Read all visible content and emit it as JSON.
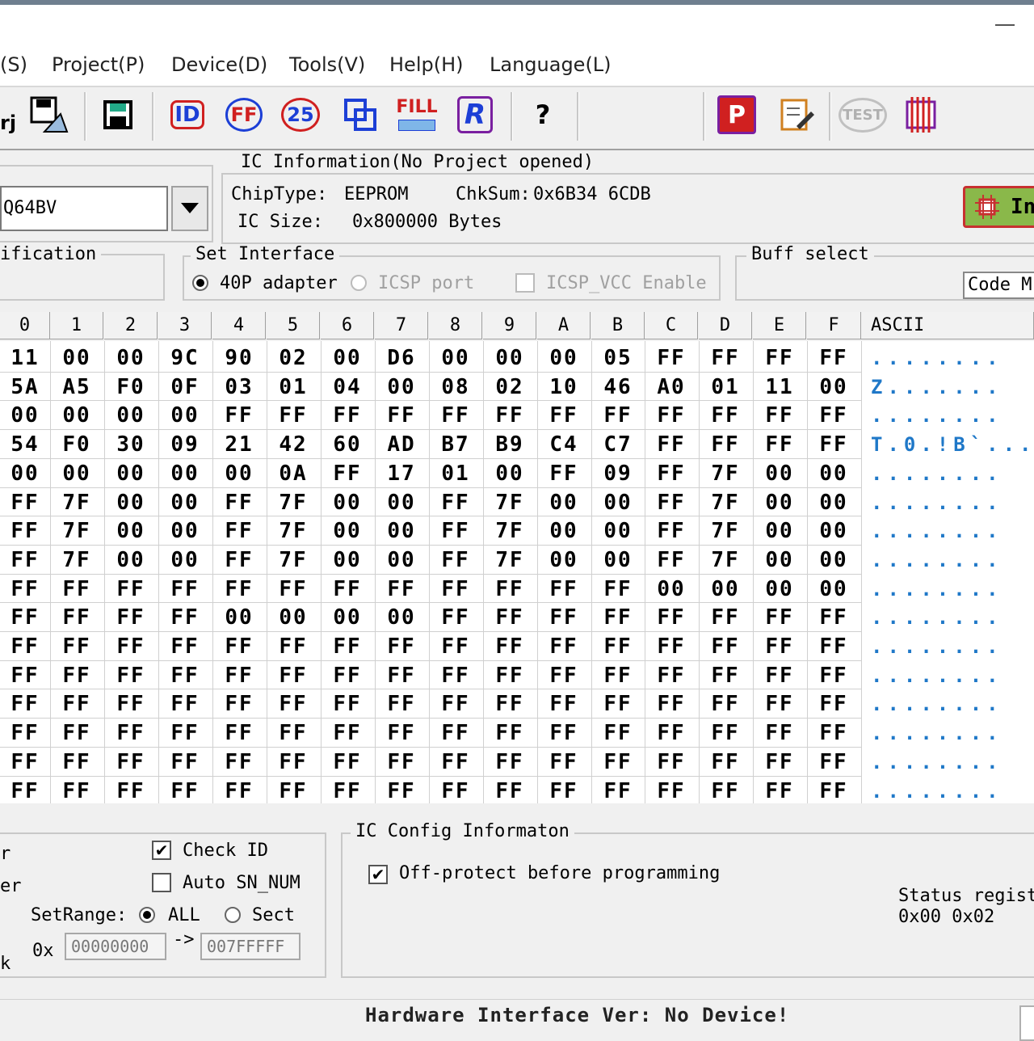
{
  "menu": [
    "(S)",
    "Project(P)",
    "Device(D)",
    "Tools(V)",
    "Help(H)",
    "Language(L)"
  ],
  "toolbar": {
    "partial_label": "rj",
    "icons": [
      "save-project-icon",
      "save-buffer-icon",
      "read-id-icon",
      "erase-icon",
      "blank-check-icon",
      "verify-icon",
      "fill-icon",
      "read-icon",
      "help-icon",
      "program-icon",
      "edit-icon",
      "test-icon",
      "chip-icon"
    ],
    "fill_label": "FILL",
    "read_label": "R",
    "program_label": "P",
    "test_label": "TEST",
    "help_label": "?",
    "id_label": "ID",
    "ff_label": "FF",
    "blank_label": "25"
  },
  "chip": {
    "selected": "Q64BV"
  },
  "ic_info": {
    "title": "IC Information(No Project opened)",
    "chip_type_label": "ChipType:",
    "chip_type_value": "EEPROM",
    "chksum_label": "ChkSum:",
    "chksum_value": "0x6B34 6CDB",
    "ic_size_label": "IC Size:",
    "ic_size_value": "0x800000 Bytes"
  },
  "detect_button": "In",
  "verification_title": "ification",
  "set_interface": {
    "title": "Set Interface",
    "adapter_label": "40P adapter",
    "icsp_label": "ICSP port",
    "icsp_vcc_label": "ICSP_VCC Enable"
  },
  "buff_select": {
    "title": "Buff select",
    "value": "Code M"
  },
  "hex": {
    "columns": [
      "0",
      "1",
      "2",
      "3",
      "4",
      "5",
      "6",
      "7",
      "8",
      "9",
      "A",
      "B",
      "C",
      "D",
      "E",
      "F"
    ],
    "ascii_header": "ASCII",
    "rows": [
      [
        "11",
        "00",
        "00",
        "9C",
        "90",
        "02",
        "00",
        "D6",
        "00",
        "00",
        "00",
        "05",
        "FF",
        "FF",
        "FF",
        "FF"
      ],
      [
        "5A",
        "A5",
        "F0",
        "0F",
        "03",
        "01",
        "04",
        "00",
        "08",
        "02",
        "10",
        "46",
        "A0",
        "01",
        "11",
        "00"
      ],
      [
        "00",
        "00",
        "00",
        "00",
        "FF",
        "FF",
        "FF",
        "FF",
        "FF",
        "FF",
        "FF",
        "FF",
        "FF",
        "FF",
        "FF",
        "FF"
      ],
      [
        "54",
        "F0",
        "30",
        "09",
        "21",
        "42",
        "60",
        "AD",
        "B7",
        "B9",
        "C4",
        "C7",
        "FF",
        "FF",
        "FF",
        "FF"
      ],
      [
        "00",
        "00",
        "00",
        "00",
        "00",
        "0A",
        "FF",
        "17",
        "01",
        "00",
        "FF",
        "09",
        "FF",
        "7F",
        "00",
        "00"
      ],
      [
        "FF",
        "7F",
        "00",
        "00",
        "FF",
        "7F",
        "00",
        "00",
        "FF",
        "7F",
        "00",
        "00",
        "FF",
        "7F",
        "00",
        "00"
      ],
      [
        "FF",
        "7F",
        "00",
        "00",
        "FF",
        "7F",
        "00",
        "00",
        "FF",
        "7F",
        "00",
        "00",
        "FF",
        "7F",
        "00",
        "00"
      ],
      [
        "FF",
        "7F",
        "00",
        "00",
        "FF",
        "7F",
        "00",
        "00",
        "FF",
        "7F",
        "00",
        "00",
        "FF",
        "7F",
        "00",
        "00"
      ],
      [
        "FF",
        "FF",
        "FF",
        "FF",
        "FF",
        "FF",
        "FF",
        "FF",
        "FF",
        "FF",
        "FF",
        "FF",
        "00",
        "00",
        "00",
        "00"
      ],
      [
        "FF",
        "FF",
        "FF",
        "FF",
        "00",
        "00",
        "00",
        "00",
        "FF",
        "FF",
        "FF",
        "FF",
        "FF",
        "FF",
        "FF",
        "FF"
      ],
      [
        "FF",
        "FF",
        "FF",
        "FF",
        "FF",
        "FF",
        "FF",
        "FF",
        "FF",
        "FF",
        "FF",
        "FF",
        "FF",
        "FF",
        "FF",
        "FF"
      ],
      [
        "FF",
        "FF",
        "FF",
        "FF",
        "FF",
        "FF",
        "FF",
        "FF",
        "FF",
        "FF",
        "FF",
        "FF",
        "FF",
        "FF",
        "FF",
        "FF"
      ],
      [
        "FF",
        "FF",
        "FF",
        "FF",
        "FF",
        "FF",
        "FF",
        "FF",
        "FF",
        "FF",
        "FF",
        "FF",
        "FF",
        "FF",
        "FF",
        "FF"
      ],
      [
        "FF",
        "FF",
        "FF",
        "FF",
        "FF",
        "FF",
        "FF",
        "FF",
        "FF",
        "FF",
        "FF",
        "FF",
        "FF",
        "FF",
        "FF",
        "FF"
      ],
      [
        "FF",
        "FF",
        "FF",
        "FF",
        "FF",
        "FF",
        "FF",
        "FF",
        "FF",
        "FF",
        "FF",
        "FF",
        "FF",
        "FF",
        "FF",
        "FF"
      ],
      [
        "FF",
        "FF",
        "FF",
        "FF",
        "FF",
        "FF",
        "FF",
        "FF",
        "FF",
        "FF",
        "FF",
        "FF",
        "FF",
        "FF",
        "FF",
        "FF"
      ]
    ],
    "ascii": [
      "........",
      "Z.......",
      "........",
      "T.0.!B`...",
      "........",
      "........",
      "........",
      "........",
      "........",
      "........",
      "........",
      "........",
      "........",
      "........",
      "........",
      "........"
    ]
  },
  "options": {
    "partial_labels": [
      "r",
      "er",
      "k"
    ],
    "check_id_label": "Check ID",
    "check_id_checked": true,
    "auto_sn_label": "Auto SN_NUM",
    "auto_sn_checked": false,
    "set_range_label": "SetRange:",
    "range_all_label": "ALL",
    "range_sect_label": "Sect",
    "hex_prefix": "0x",
    "range_start": "00000000",
    "range_arrow": "->",
    "range_end": "007FFFFF"
  },
  "ic_config": {
    "title": "IC Config Informaton",
    "off_protect_label": "Off-protect before programming",
    "off_protect_checked": true,
    "status_reg_label": "Status regist",
    "status_reg_value": "0x00 0x02"
  },
  "status_bar": {
    "text": "Hardware Interface Ver: No Device!"
  }
}
